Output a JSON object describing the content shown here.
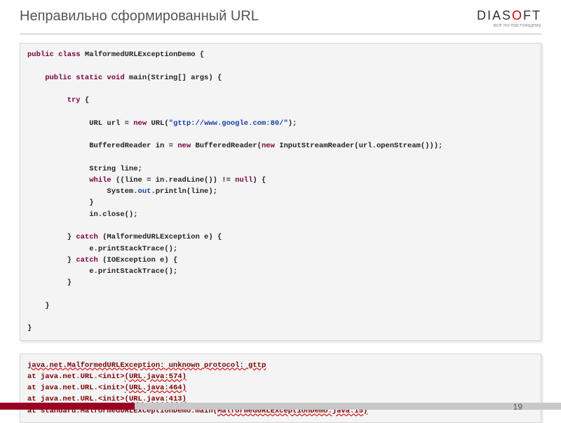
{
  "header": {
    "title": "Неправильно сформированный URL",
    "logo_main_prefix": "DIAS",
    "logo_main_red": "O",
    "logo_main_suffix": "FT",
    "logo_sub": "всё по-настоящему"
  },
  "code": {
    "t01a": "public class",
    "t01b": " MalformedURLExceptionDemo {",
    "t02a": "    public static void",
    "t02b": " main(String[] args) {",
    "t03a": "         try",
    "t03b": " {",
    "t04a": "              URL url = ",
    "t04b": "new",
    "t04c": " URL(",
    "t04d": "\"gttp://www.google.com:80/\"",
    "t04e": ");",
    "t05a": "              BufferedReader in = ",
    "t05b": "new",
    "t05c": " BufferedReader(",
    "t05d": "new",
    "t05e": " InputStreamReader(url.openStream()));",
    "t06": "              String line;",
    "t07a": "              while",
    "t07b": " ((line = in.readLine()) != ",
    "t07c": "null",
    "t07d": ") {",
    "t08a": "                  System.",
    "t08b": "out",
    "t08c": ".println(line);",
    "t09": "              }",
    "t10": "              in.close();",
    "t11a": "         } ",
    "t11b": "catch",
    "t11c": " (MalformedURLException e) {",
    "t12": "              e.printStackTrace();",
    "t13a": "         } ",
    "t13b": "catch",
    "t13c": " (IOException e) {",
    "t14": "              e.printStackTrace();",
    "t15": "         }",
    "t16": "    }",
    "t17": "}"
  },
  "error": {
    "l1a": "java.net.MalformedURLException",
    "l1b": ": unknown protocol: gttp",
    "l2a": "at java.net.URL.<init>",
    "l2b": "(",
    "l2c": "URL.java:574",
    "l2d": ")",
    "l3a": "at java.net.URL.<init>",
    "l3b": "(",
    "l3c": "URL.java:464",
    "l3d": ")",
    "l4a": "at java.net.URL.<init>",
    "l4b": "(",
    "l4c": "URL.java:413",
    "l4d": ")",
    "l5a": "at standard.MalformedURLExceptionDemo.main(",
    "l5b": "MalformedURLExceptionDemo.java:15",
    "l5c": ")"
  },
  "page_number": "19"
}
